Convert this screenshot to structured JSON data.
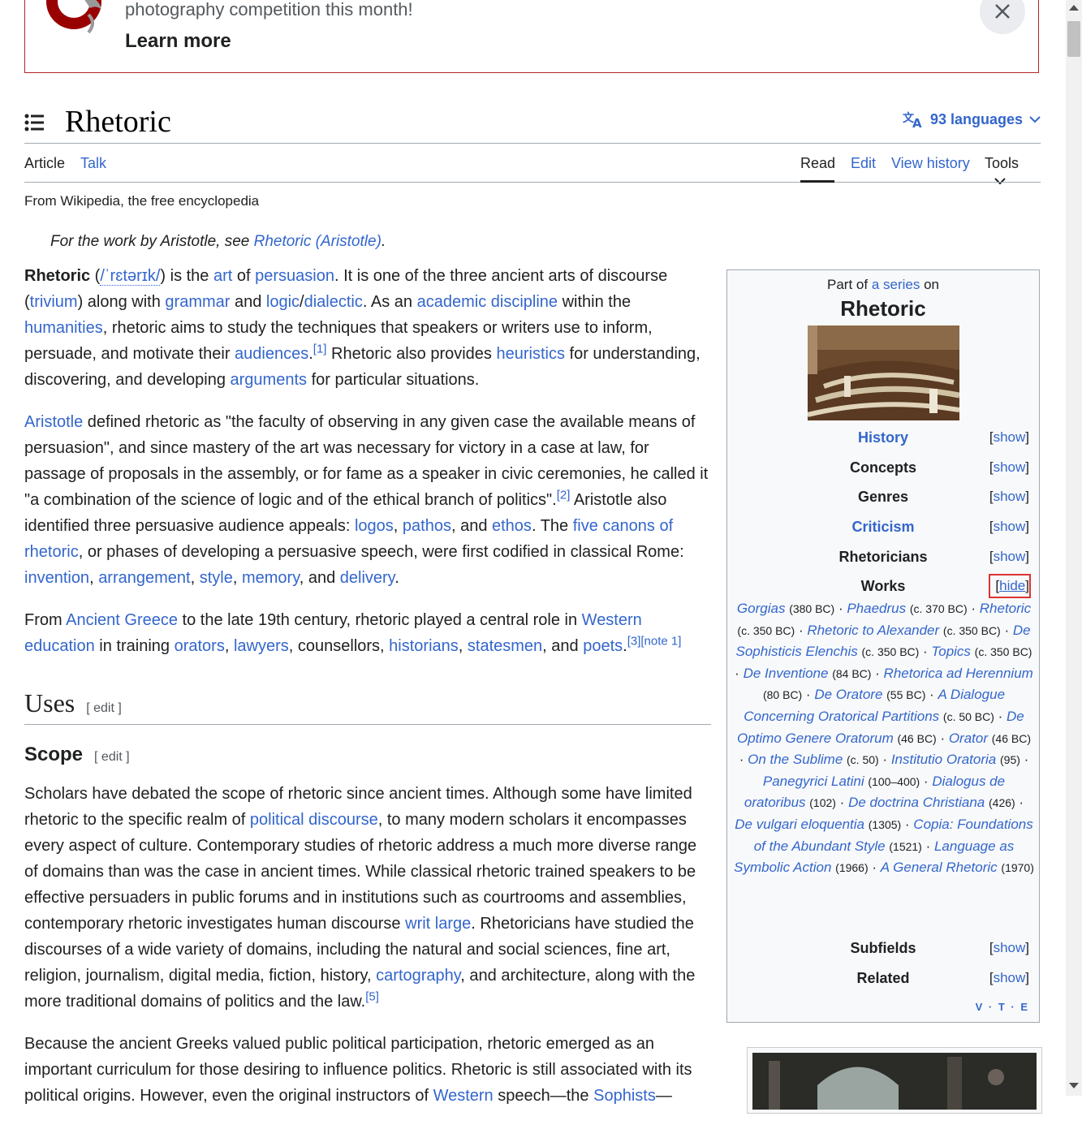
{
  "banner": {
    "message": "photography competition this month!",
    "learn_more": "Learn more"
  },
  "page": {
    "title": "Rhetoric",
    "languages": "93 languages",
    "tagline": "From Wikipedia, the free encyclopedia"
  },
  "tabs": {
    "article": "Article",
    "talk": "Talk",
    "read": "Read",
    "edit": "Edit",
    "history": "View history",
    "tools": "Tools"
  },
  "hatnote": {
    "prefix": "For the work by Aristotle, see ",
    "link": "Rhetoric (Aristotle)",
    "suffix": "."
  },
  "sections": {
    "uses": "Uses",
    "scope": "Scope",
    "edit": "[ edit ]"
  },
  "infobox": {
    "part_of": "Part of",
    "a_series": "a series",
    "on": "on",
    "title": "Rhetoric",
    "rows": [
      {
        "label": "History",
        "toggle": "show",
        "link": true
      },
      {
        "label": "Concepts",
        "toggle": "show",
        "link": false
      },
      {
        "label": "Genres",
        "toggle": "show",
        "link": false
      },
      {
        "label": "Criticism",
        "toggle": "show",
        "link": true
      },
      {
        "label": "Rhetoricians",
        "toggle": "show",
        "link": false
      },
      {
        "label": "Works",
        "toggle": "hide",
        "link": false
      },
      {
        "label": "Subfields",
        "toggle": "show",
        "link": false
      },
      {
        "label": "Related",
        "toggle": "show",
        "link": false
      }
    ],
    "works": [
      {
        "title": "Gorgias",
        "year": "(380 BC)"
      },
      {
        "title": "Phaedrus",
        "year": "(c. 370 BC)"
      },
      {
        "title": "Rhetoric",
        "year": "(c. 350 BC)"
      },
      {
        "title": "Rhetoric to Alexander",
        "year": "(c. 350 BC)"
      },
      {
        "title": "De Sophisticis Elenchis",
        "year": "(c. 350 BC)"
      },
      {
        "title": "Topics",
        "year": "(c. 350 BC)"
      },
      {
        "title": "De Inventione",
        "year": "(84 BC)"
      },
      {
        "title": "Rhetorica ad Herennium",
        "year": "(80 BC)"
      },
      {
        "title": "De Oratore",
        "year": "(55 BC)"
      },
      {
        "title": "A Dialogue Concerning Oratorical Partitions",
        "year": "(c. 50 BC)"
      },
      {
        "title": "De Optimo Genere Oratorum",
        "year": "(46 BC)"
      },
      {
        "title": "Orator",
        "year": "(46 BC)"
      },
      {
        "title": "On the Sublime",
        "year": "(c. 50)"
      },
      {
        "title": "Institutio Oratoria",
        "year": "(95)"
      },
      {
        "title": "Panegyrici Latini",
        "year": "(100–400)"
      },
      {
        "title": "Dialogus de oratoribus",
        "year": "(102)"
      },
      {
        "title": "De doctrina Christiana",
        "year": "(426)"
      },
      {
        "title": "De vulgari eloquentia",
        "year": "(1305)"
      },
      {
        "title": "Copia: Foundations of the Abundant Style",
        "year": "(1521)"
      },
      {
        "title": "Language as Symbolic Action",
        "year": "(1966)"
      },
      {
        "title": "A General Rhetoric",
        "year": "(1970)"
      }
    ],
    "vte": "V · T · E"
  },
  "colors": {
    "link": "#3366cc",
    "text": "#202122",
    "banner_border": "#b32424",
    "highlight": "#dd3333"
  }
}
